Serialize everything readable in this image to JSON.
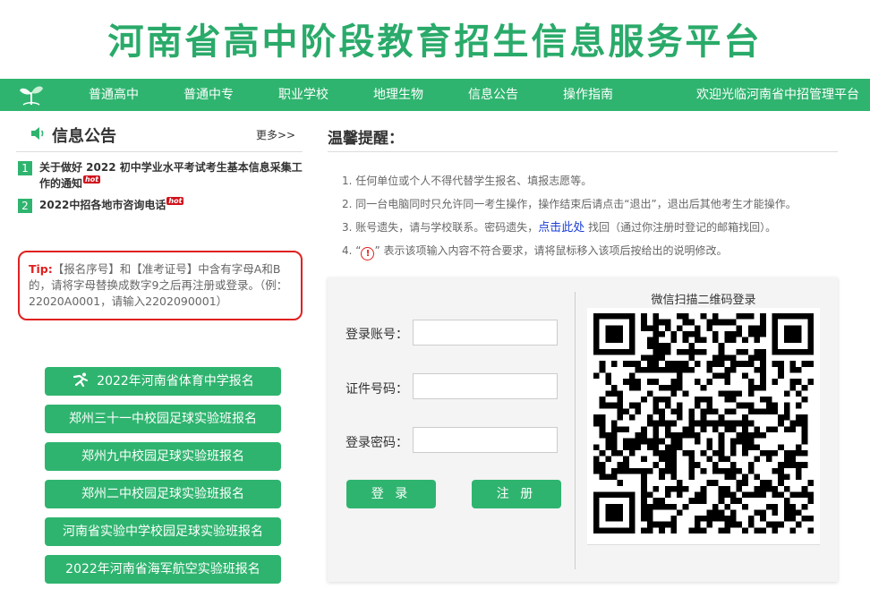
{
  "site": {
    "title": "河南省高中阶段教育招生信息服务平台"
  },
  "nav": {
    "items": [
      "普通高中",
      "普通中专",
      "职业学校",
      "地理生物",
      "信息公告",
      "操作指南"
    ],
    "welcome": "欢迎光临河南省中招管理平台"
  },
  "notice": {
    "title": "信息公告",
    "more": "更多>>",
    "items": [
      {
        "num": "1",
        "text": "关于做好 2022 初中学业水平考试考生基本信息采集工作的通知",
        "badge": "hot"
      },
      {
        "num": "2",
        "text": "2022中招各地市咨询电话",
        "badge": "hot"
      }
    ]
  },
  "tip": {
    "label": "Tip:",
    "text": "【报名序号】和【准考证号】中含有字母A和B的，请将字母替换成数字9之后再注册或登录。（例：22020A0001，请输入2202090001）"
  },
  "left_buttons": [
    "2022年河南省体育中学报名",
    "郑州三十一中校园足球实验班报名",
    "郑州九中校园足球实验班报名",
    "郑州二中校园足球实验班报名",
    "河南省实验中学校园足球实验班报名",
    "2022年河南省海军航空实验班报名"
  ],
  "reminder": {
    "title": "温馨提醒：",
    "item1": "1. 任何单位或个人不得代替学生报名、填报志愿等。",
    "item2": "2. 同一台电脑同时只允许同一考生操作，操作结束后请点击“退出”，退出后其他考生才能操作。",
    "item3_pre": "3. 账号遗失，请与学校联系。密码遗失，",
    "item3_link": "点击此处",
    "item3_post": " 找回（通过你注册时登记的邮箱找回）。",
    "item4_pre": "4. “",
    "item4_icon": "!",
    "item4_post": "” 表示该项输入内容不符合要求，请将鼠标移入该项后按给出的说明修改。"
  },
  "login": {
    "account_label": "登录账号：",
    "account_value": "",
    "id_label": "证件号码：",
    "id_value": "",
    "password_label": "登录密码：",
    "password_value": "",
    "login_button": "登 录",
    "register_button": "注 册"
  },
  "qr": {
    "title": "微信扫描二维码登录"
  },
  "colors": {
    "brand_green": "#2fb46f",
    "alert_red": "#e02020",
    "link_blue": "#1a3dd6"
  }
}
